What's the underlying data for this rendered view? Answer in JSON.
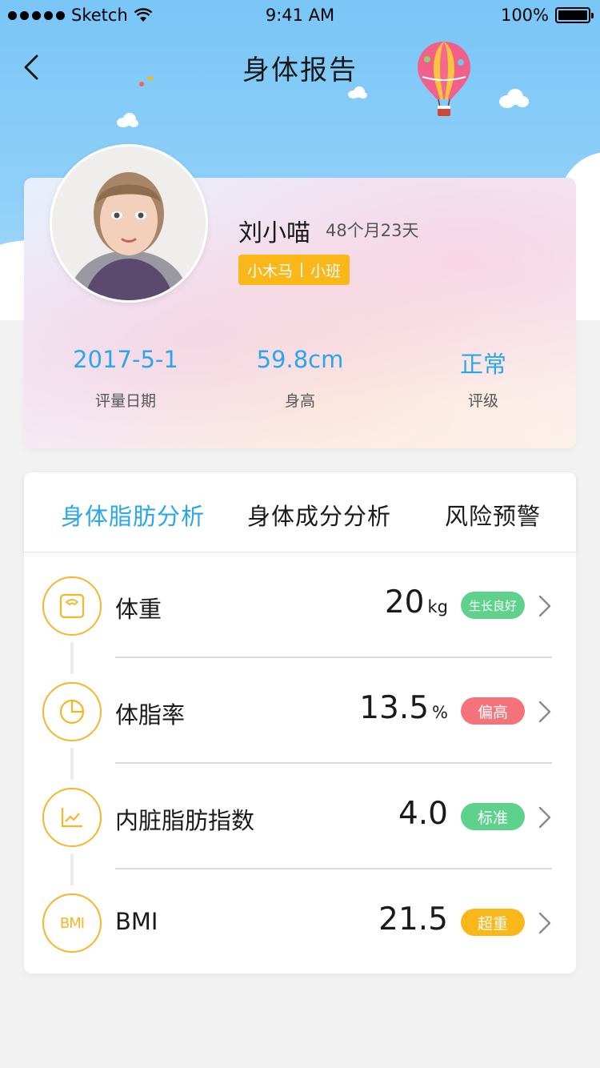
{
  "status_bar": {
    "carrier": "Sketch",
    "time": "9:41 AM",
    "battery": "100%"
  },
  "nav": {
    "title": "身体报告"
  },
  "profile": {
    "name": "刘小喵",
    "age": "48个月23天",
    "class_tag": {
      "school": "小木马",
      "grade": "小班"
    },
    "stats": [
      {
        "value": "2017-5-1",
        "label": "评量日期"
      },
      {
        "value": "59.8cm",
        "label": "身高"
      },
      {
        "value": "正常",
        "label": "评级"
      }
    ]
  },
  "tabs": [
    {
      "label": "身体脂肪分析",
      "active": true
    },
    {
      "label": "身体成分分析",
      "active": false
    },
    {
      "label": "风险预警",
      "active": false
    }
  ],
  "metrics": [
    {
      "label": "体重",
      "value": "20",
      "unit": "kg",
      "badge": "生长良好",
      "badge_color": "#5ed28c",
      "icon": "scale-icon"
    },
    {
      "label": "体脂率",
      "value": "13.5",
      "unit": "%",
      "badge": "偏高",
      "badge_color": "#f4737a",
      "icon": "pie-chart-icon"
    },
    {
      "label": "内脏脂肪指数",
      "value": "4.0",
      "unit": "",
      "badge": "标准",
      "badge_color": "#5ed28c",
      "icon": "line-chart-icon"
    },
    {
      "label": "BMI",
      "value": "21.5",
      "unit": "",
      "badge": "超重",
      "badge_color": "#f9b71a",
      "icon": "bmi-icon",
      "icon_text": "BMI"
    }
  ],
  "colors": {
    "accent_blue": "#2aa7ea",
    "accent_orange": "#f9b71a",
    "sky": "#79c6f7"
  }
}
